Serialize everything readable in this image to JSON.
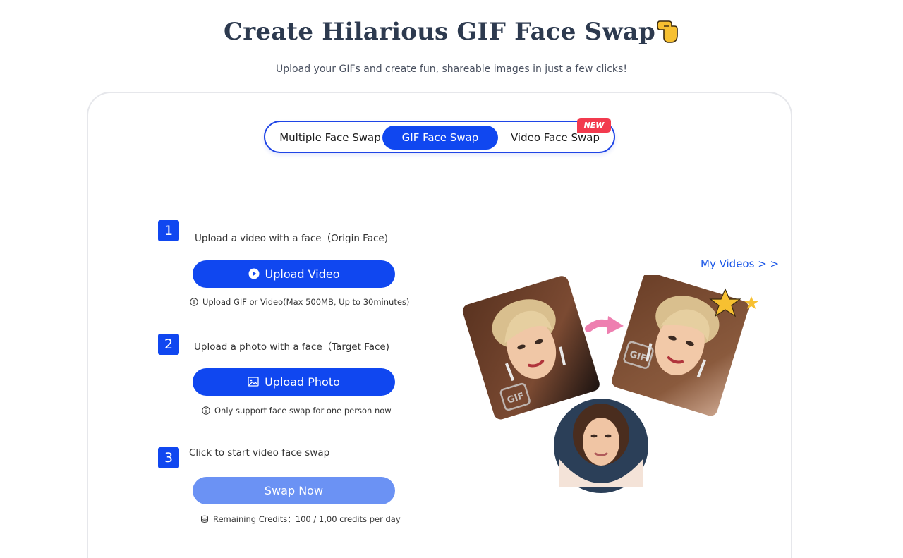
{
  "header": {
    "title": "Create Hilarious GIF Face Swap",
    "subtitle": "Upload your GIFs and create fun, shareable images in just a few clicks!"
  },
  "tabs": [
    {
      "label": "Multiple Face Swap",
      "active": false
    },
    {
      "label": "GIF Face Swap",
      "active": true
    },
    {
      "label": "Video Face Swap",
      "active": false
    }
  ],
  "new_badge": "NEW",
  "steps": [
    {
      "number": "1",
      "text": "Upload a video with a face（Origin Face)",
      "button": "Upload Video",
      "hint": "Upload GIF or Video(Max 500MB, Up to 30minutes)"
    },
    {
      "number": "2",
      "text": "Upload a photo with a face（Target Face)",
      "button": "Upload Photo",
      "hint": "Only support face swap for one person now"
    },
    {
      "number": "3",
      "text": "Click to start video face swap",
      "button": "Swap Now",
      "hint": "Remaining Credits：100 / 1,00 credits per day"
    }
  ],
  "my_videos_link": "My Videos > >",
  "illustration": {
    "gif_label": "GIF"
  },
  "colors": {
    "primary": "#1047f0",
    "disabled": "#6b92f4",
    "badge": "#f23a4e",
    "link": "#1f5ae8",
    "title": "#2d3a4f"
  },
  "icons": [
    "hand-pointing-icon",
    "play-circle-icon",
    "image-icon",
    "info-icon",
    "coins-icon",
    "arrow-icon",
    "star-icon"
  ]
}
